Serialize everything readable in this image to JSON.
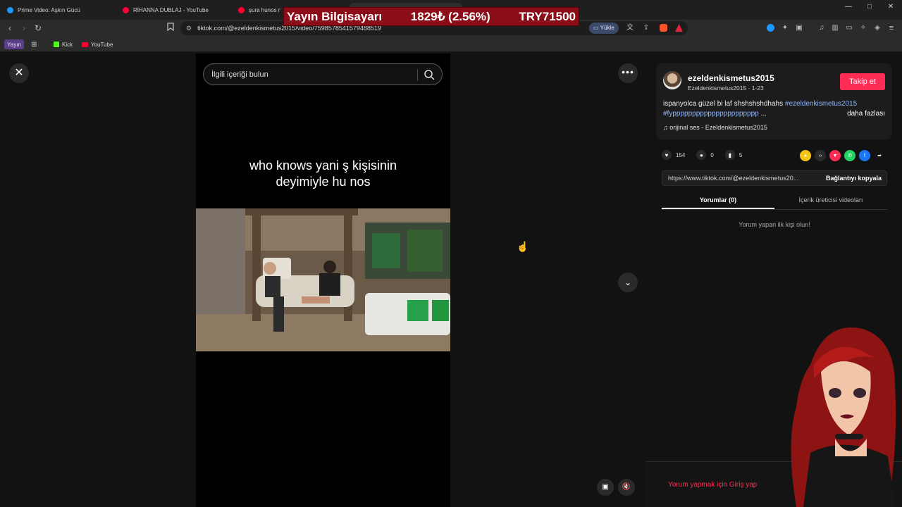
{
  "tabs": [
    {
      "title": "Prime Video: Aşkın Gücü",
      "color": "#1a98ff"
    },
    {
      "title": "RİHANNA DUBLAJ - YouTube",
      "color": "#ff0033"
    },
    {
      "title": "şura hunos n",
      "color": "#ff0033"
    }
  ],
  "window_controls": {
    "minimize": "—",
    "maximize": "□",
    "close": "✕"
  },
  "stream_banner": {
    "left": "Yayın Bilgisayarı",
    "middle": "1829₺ (2.56%)",
    "right": "TRY71500"
  },
  "url": "tiktok.com/@ezeldenkismetus2015/video/7598578541579488519",
  "yukle_label": "Yükle",
  "bookmarks": {
    "yayin": "Yayın",
    "kick": "Kick",
    "youtube": "YouTube"
  },
  "video": {
    "search_placeholder": "İlgili içeriği bulun",
    "caption_line1": "who knows yani ş kişisinin",
    "caption_line2": "deyimiyle hu nos"
  },
  "author": {
    "username": "ezeldenkismetus2015",
    "subline": "Ezeldenkismetus2015 · 1-23",
    "follow_label": "Takip et"
  },
  "description": {
    "text": "ispanyolca güzel bi laf shshshshdhahs",
    "tag1": "#ezeldenkismetus2015",
    "tag2": "#fypppppppppppppppppppppp",
    "ellipsis": "...",
    "more": "daha fazlası"
  },
  "music": "orijinal ses - Ezeldenkismetus2015",
  "stats": {
    "likes": "154",
    "comments": "0",
    "saves": "5"
  },
  "share_colors": [
    "#f5c518",
    "#2a2a2a",
    "#fe2c55",
    "#25d366",
    "#1877f2"
  ],
  "link": {
    "url": "https://www.tiktok.com/@ezeldenkismetus20...",
    "copy_label": "Bağlantıyı kopyala"
  },
  "comment_tabs": {
    "comments": "Yorumlar (0)",
    "creator_videos": "İçerik üreticisi videoları"
  },
  "empty_comments": "Yorum yapan ilk kişi olun!",
  "login_prompt": "Yorum yapmak için Giriş yap"
}
